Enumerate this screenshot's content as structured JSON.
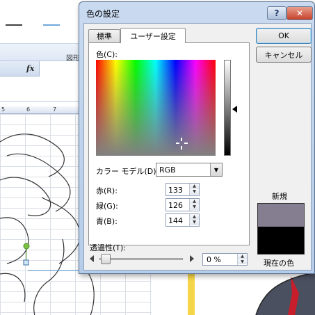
{
  "background": {
    "ribbon_group_label": "図形",
    "formula_fx": "fx",
    "column_headers": [
      "5",
      "6",
      "7"
    ]
  },
  "dialog": {
    "title": "色の設定",
    "help_glyph": "?",
    "close_glyph": "✕",
    "tabs": [
      {
        "label": "標準",
        "active": false
      },
      {
        "label": "ユーザー設定",
        "active": true
      }
    ],
    "colors_label": "色(C):",
    "color_model_label": "カラー モデル(D):",
    "color_model_value": "RGB",
    "red_label": "赤(R):",
    "red_value": "133",
    "green_label": "緑(G):",
    "green_value": "126",
    "blue_label": "青(B):",
    "blue_value": "144",
    "ok_label": "OK",
    "cancel_label": "キャンセル",
    "new_label": "新規",
    "current_label": "現在の色",
    "new_color": "#857e90",
    "current_color": "#000000",
    "transparency_label": "透過性(T):",
    "transparency_value": "0 %",
    "transparency_level": 0
  },
  "colors": {
    "accent_blue": "#6fa8dc",
    "dark_line": "#404040",
    "shape_handle_green": "#7dc242"
  }
}
